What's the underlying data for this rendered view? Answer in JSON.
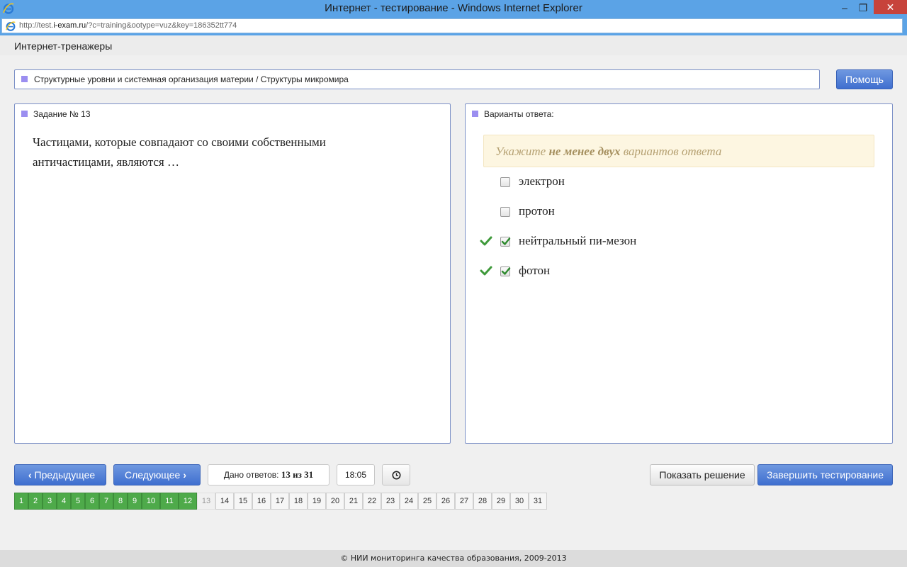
{
  "window": {
    "title": "Интернет - тестирование - Windows Internet Explorer",
    "minimize": "–",
    "maximize": "❐",
    "close": "✕"
  },
  "address": {
    "url_prefix": "http://test.",
    "url_domain": "i-exam.ru",
    "url_rest": "/?c=training&ootype=vuz&key=186352tt774"
  },
  "app": {
    "title": "Интернет-тренажеры"
  },
  "breadcrumb": "Структурные уровни и системная организация материи / Структуры микромира",
  "help_label": "Помощь",
  "task": {
    "title": "Задание № 13",
    "question": "Частицами, которые совпадают со своими собственными античастицами, являются …"
  },
  "answers": {
    "title": "Варианты ответа:",
    "hint_pre": "Укажите ",
    "hint_bold": "не менее двух",
    "hint_post": " вариантов ответа",
    "options": [
      {
        "label": "электрон",
        "checked": false,
        "correct": false
      },
      {
        "label": "протон",
        "checked": false,
        "correct": false
      },
      {
        "label": "нейтральный пи-мезон",
        "checked": true,
        "correct": true
      },
      {
        "label": "фотон",
        "checked": true,
        "correct": true
      }
    ]
  },
  "nav": {
    "prev_label": "Предыдущее",
    "next_label": "Следующее",
    "answered_label": "Дано ответов:",
    "answered_value": "13 из 31",
    "timer": "18:05",
    "show_solution_label": "Показать решение",
    "finish_label": "Завершить тестирование"
  },
  "pager": {
    "pages": [
      "1",
      "2",
      "3",
      "4",
      "5",
      "6",
      "7",
      "8",
      "9",
      "10",
      "11",
      "12",
      "13",
      "14",
      "15",
      "16",
      "17",
      "18",
      "19",
      "20",
      "21",
      "22",
      "23",
      "24",
      "25",
      "26",
      "27",
      "28",
      "29",
      "30",
      "31"
    ],
    "answered_count": 12,
    "current": 13
  },
  "colors": {
    "accent_blue": "#4a78d4",
    "done_green": "#4eaa4a",
    "panel_border": "#7b8fc6",
    "marker_purple": "#9b8ef0",
    "hint_bg": "#fdf6e1"
  },
  "footer": "© НИИ мониторинга качества образования, 2009-2013"
}
